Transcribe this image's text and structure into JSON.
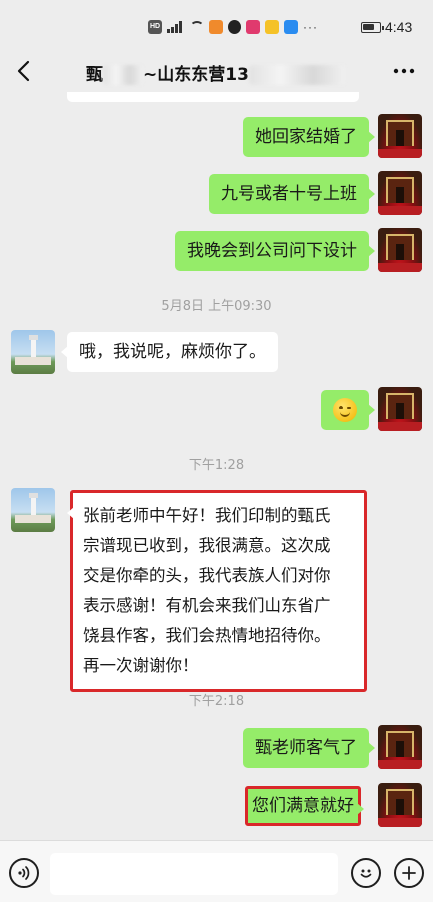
{
  "status_bar": {
    "time": "4:43",
    "hd_label": "HD",
    "icons": [
      "hd-icon",
      "signal-icon",
      "wifi-icon",
      "app-notification-icons",
      "more-notifications-icon",
      "battery-icon"
    ]
  },
  "header": {
    "title_prefix": "甄",
    "title_middle": "~山东东营13",
    "back_icon": "chevron-left-icon",
    "more_icon": "ellipsis-icon"
  },
  "messages": [
    {
      "type": "out",
      "text": "她回家结婚了"
    },
    {
      "type": "out",
      "text": "九号或者十号上班"
    },
    {
      "type": "out",
      "text": "我晚会到公司问下设计"
    },
    {
      "type": "time",
      "text": "5月8日 上午09:30"
    },
    {
      "type": "in",
      "text": "哦，我说呢，麻烦你了。"
    },
    {
      "type": "out",
      "emoji": "smile-emoji"
    },
    {
      "type": "time",
      "text": "下午1:28"
    },
    {
      "type": "in",
      "highlighted": true,
      "text": "张前老师中午好！我们印制的甄氏宗谱现已收到，我很满意。这次成交是你牵的头，我代表族人们对你表示感谢！有机会来我们山东省广饶县作客，我们会热情地招待你。再一次谢谢你！"
    },
    {
      "type": "time",
      "text": "下午2:18"
    },
    {
      "type": "out",
      "text": "甄老师客气了"
    },
    {
      "type": "out",
      "highlighted": true,
      "text": "您们满意就好"
    }
  ],
  "message_lines": {
    "long_1": "张前老师中午好！我们印制的甄氏",
    "long_2": "宗谱现已收到，我很满意。这次成",
    "long_3": "交是你牵的头，我代表族人们对你",
    "long_4": "表示感谢！有机会来我们山东省广",
    "long_5": "饶县作客，我们会热情地招待你。",
    "long_6": "再一次谢谢你！"
  },
  "colors": {
    "outgoing_bubble": "#95ec69",
    "incoming_bubble": "#ffffff",
    "highlight_border": "#d9282a",
    "background": "#ededed"
  },
  "input_bar": {
    "value": "",
    "voice_icon": "voice-icon",
    "emoji_icon": "emoji-icon",
    "add_icon": "plus-circle-icon"
  }
}
